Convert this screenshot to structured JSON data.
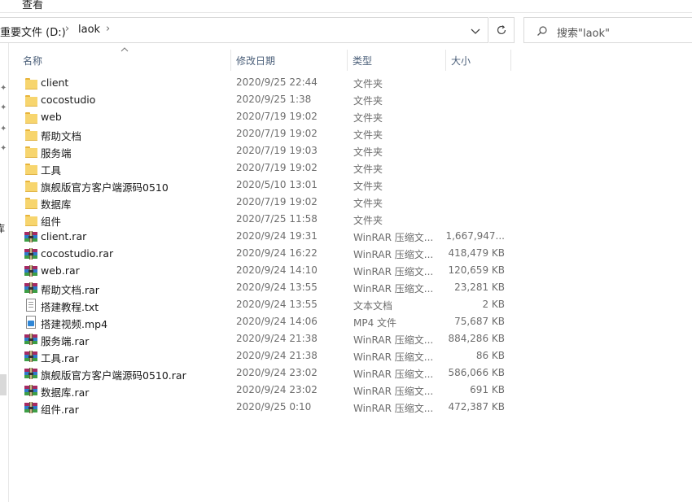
{
  "ribbon": {
    "tab_view": "查看"
  },
  "address": {
    "crumbs": [
      "重要文件 (D:)",
      "laok"
    ],
    "separator": "›"
  },
  "search": {
    "placeholder": "搜索\"laok\""
  },
  "nav": {
    "fragment": "库"
  },
  "columns": {
    "name": "名称",
    "date": "修改日期",
    "type": "类型",
    "size": "大小"
  },
  "files": [
    {
      "name": "client",
      "date": "2020/9/25 22:44",
      "type": "文件夹",
      "size": "",
      "icon": "folder-icon"
    },
    {
      "name": "cocostudio",
      "date": "2020/9/25 1:38",
      "type": "文件夹",
      "size": "",
      "icon": "folder-icon"
    },
    {
      "name": "web",
      "date": "2020/7/19 19:02",
      "type": "文件夹",
      "size": "",
      "icon": "folder-icon"
    },
    {
      "name": "帮助文档",
      "date": "2020/7/19 19:02",
      "type": "文件夹",
      "size": "",
      "icon": "folder-icon"
    },
    {
      "name": "服务端",
      "date": "2020/7/19 19:03",
      "type": "文件夹",
      "size": "",
      "icon": "folder-icon"
    },
    {
      "name": "工具",
      "date": "2020/7/19 19:02",
      "type": "文件夹",
      "size": "",
      "icon": "folder-icon"
    },
    {
      "name": "旗舰版官方客户端源码0510",
      "date": "2020/5/10 13:01",
      "type": "文件夹",
      "size": "",
      "icon": "folder-icon"
    },
    {
      "name": "数据库",
      "date": "2020/7/19 19:02",
      "type": "文件夹",
      "size": "",
      "icon": "folder-icon"
    },
    {
      "name": "组件",
      "date": "2020/7/25 11:58",
      "type": "文件夹",
      "size": "",
      "icon": "folder-icon"
    },
    {
      "name": "client.rar",
      "date": "2020/9/24 19:31",
      "type": "WinRAR 压缩文...",
      "size": "1,667,947...",
      "icon": "rar-archive-icon"
    },
    {
      "name": "cocostudio.rar",
      "date": "2020/9/24 16:22",
      "type": "WinRAR 压缩文...",
      "size": "418,479 KB",
      "icon": "rar-archive-icon"
    },
    {
      "name": "web.rar",
      "date": "2020/9/24 14:10",
      "type": "WinRAR 压缩文...",
      "size": "120,659 KB",
      "icon": "rar-archive-icon"
    },
    {
      "name": "帮助文档.rar",
      "date": "2020/9/24 13:55",
      "type": "WinRAR 压缩文...",
      "size": "23,281 KB",
      "icon": "rar-archive-icon"
    },
    {
      "name": "搭建教程.txt",
      "date": "2020/9/24 13:55",
      "type": "文本文档",
      "size": "2 KB",
      "icon": "text-file-icon"
    },
    {
      "name": "搭建视频.mp4",
      "date": "2020/9/24 14:06",
      "type": "MP4 文件",
      "size": "75,687 KB",
      "icon": "video-file-icon"
    },
    {
      "name": "服务端.rar",
      "date": "2020/9/24 21:38",
      "type": "WinRAR 压缩文...",
      "size": "884,286 KB",
      "icon": "rar-archive-icon"
    },
    {
      "name": "工具.rar",
      "date": "2020/9/24 21:38",
      "type": "WinRAR 压缩文...",
      "size": "86 KB",
      "icon": "rar-archive-icon"
    },
    {
      "name": "旗舰版官方客户端源码0510.rar",
      "date": "2020/9/24 23:02",
      "type": "WinRAR 压缩文...",
      "size": "586,066 KB",
      "icon": "rar-archive-icon"
    },
    {
      "name": "数据库.rar",
      "date": "2020/9/24 23:02",
      "type": "WinRAR 压缩文...",
      "size": "691 KB",
      "icon": "rar-archive-icon"
    },
    {
      "name": "组件.rar",
      "date": "2020/9/25 0:10",
      "type": "WinRAR 压缩文...",
      "size": "472,387 KB",
      "icon": "rar-archive-icon"
    }
  ]
}
